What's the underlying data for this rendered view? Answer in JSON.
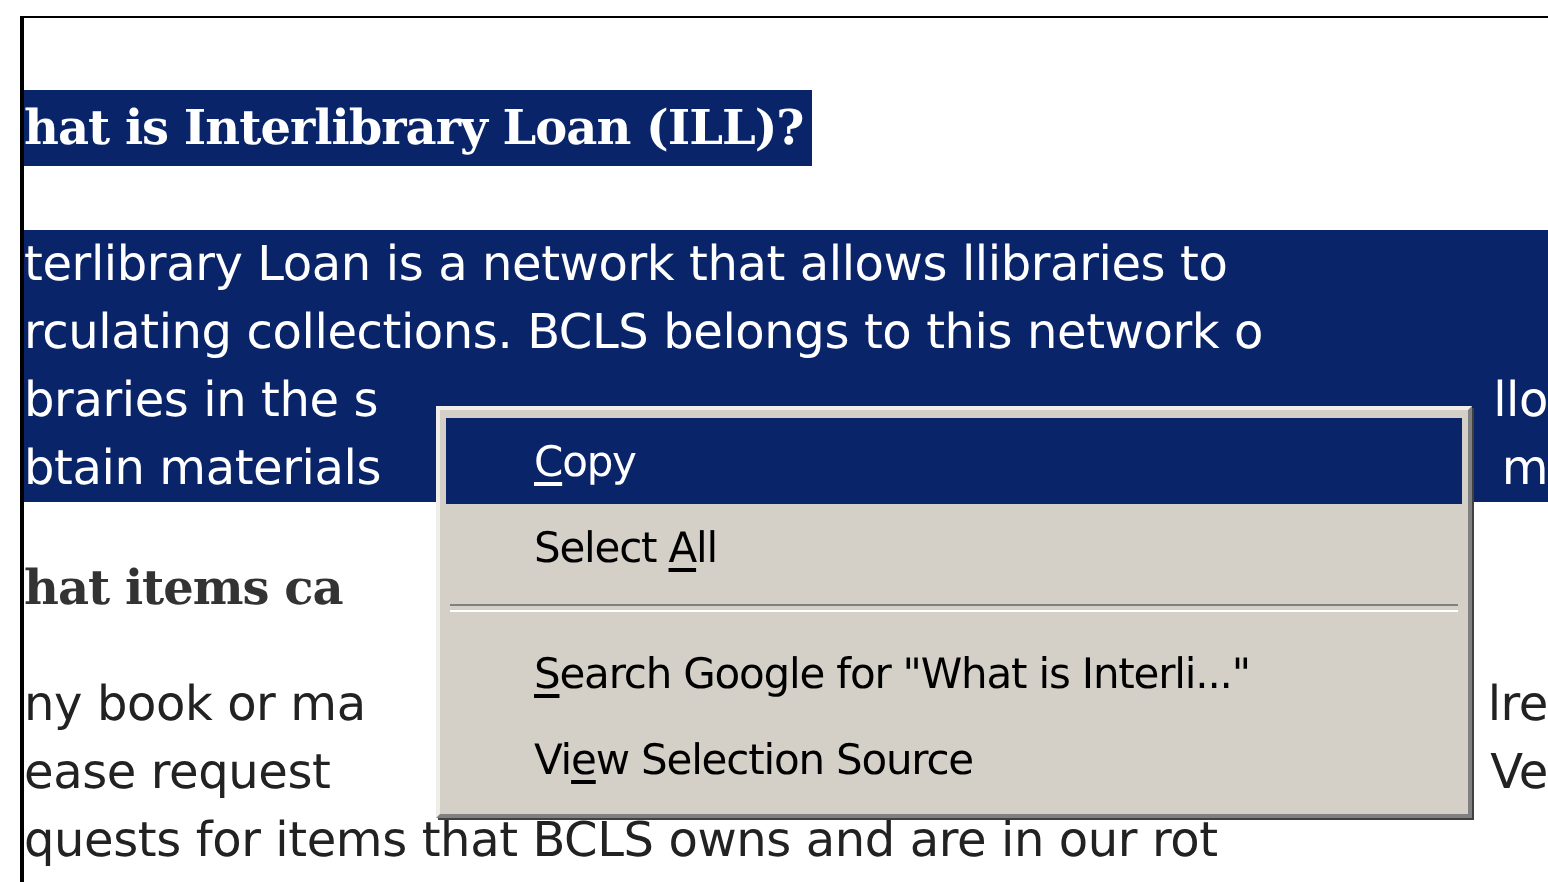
{
  "page": {
    "sections": [
      {
        "heading": "hat is Interlibrary Loan (ILL)?",
        "heading_selected": true,
        "selected": true,
        "lines": [
          {
            "left": "terlibrary Loan is a network that allows llibraries to"
          },
          {
            "left": "rculating collections. BCLS belongs to this network o"
          },
          {
            "left": "braries in the s",
            "right": "llo"
          },
          {
            "left": "btain materials",
            "right": "m"
          }
        ]
      },
      {
        "heading": "hat items ca",
        "heading_selected": false,
        "selected": false,
        "lines": [
          {
            "left": "ny book or ma",
            "right": "lre"
          },
          {
            "left": "ease request",
            "right": "Ve"
          },
          {
            "left": "quests for items that BCLS owns and are in our rot"
          }
        ]
      }
    ]
  },
  "context_menu": {
    "items": [
      {
        "kind": "item",
        "label": [
          {
            "text": "C",
            "underline": true
          },
          {
            "text": "opy",
            "underline": false
          }
        ],
        "selected": true
      },
      {
        "kind": "item",
        "label": [
          {
            "text": "Select ",
            "underline": false
          },
          {
            "text": "A",
            "underline": true
          },
          {
            "text": "ll",
            "underline": false
          }
        ],
        "selected": false
      },
      {
        "kind": "separator"
      },
      {
        "kind": "item",
        "label": [
          {
            "text": "S",
            "underline": true
          },
          {
            "text": "earch Google for \"What is Interli...\"",
            "underline": false
          }
        ],
        "selected": false
      },
      {
        "kind": "item",
        "label": [
          {
            "text": "Vi",
            "underline": false
          },
          {
            "text": "e",
            "underline": true
          },
          {
            "text": "w Selection Source",
            "underline": false
          }
        ],
        "selected": false
      }
    ]
  }
}
